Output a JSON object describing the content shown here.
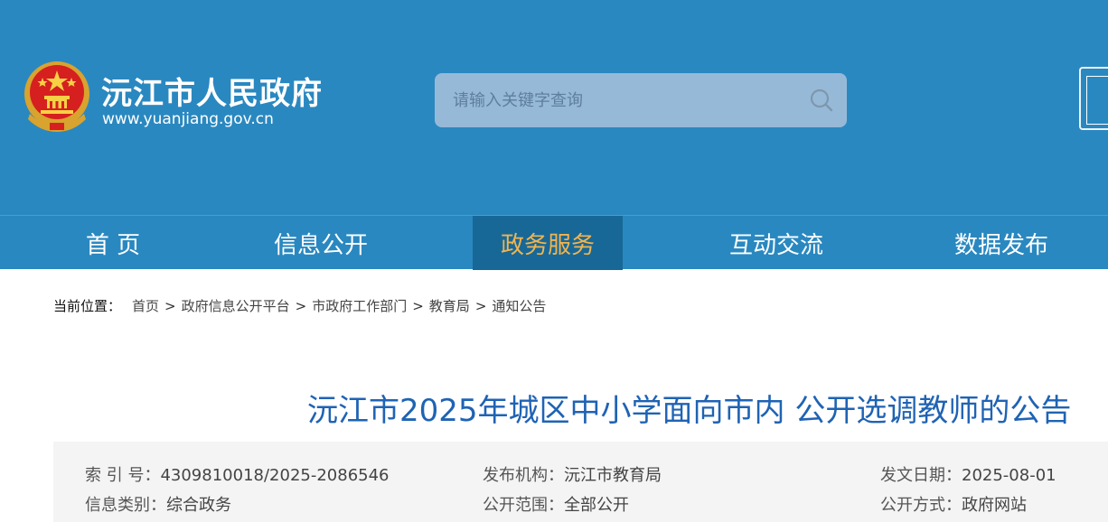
{
  "header": {
    "site_name": "沅江市人民政府",
    "site_url": "www.yuanjiang.gov.cn",
    "search_placeholder": "请输入关键字查询",
    "colors": {
      "header_bg": "#2a88c0",
      "nav_active_bg": "#176897",
      "nav_active_text": "#f2b450",
      "title": "#1f63b4"
    }
  },
  "nav": {
    "items": [
      "首 页",
      "信息公开",
      "政务服务",
      "互动交流",
      "数据发布"
    ],
    "active_index": 2
  },
  "breadcrumb": {
    "lead": "当前位置：",
    "items": [
      "首页",
      "政府信息公开平台",
      "市政府工作部门",
      "教育局",
      "通知公告"
    ],
    "separator": ">"
  },
  "article": {
    "title": "沅江市2025年城区中小学面向市内 公开选调教师的公告"
  },
  "meta": {
    "index_label": "索 引 号：",
    "index_value": "4309810018/2025-2086546",
    "publisher_label": "发布机构：",
    "publisher_value": "沅江市教育局",
    "date_label": "发文日期：",
    "date_value": "2025-08-01",
    "category_label": "信息类别：",
    "category_value": "综合政务",
    "scope_label": "公开范围：",
    "scope_value": "全部公开",
    "method_label": "公开方式：",
    "method_value": "政府网站"
  }
}
